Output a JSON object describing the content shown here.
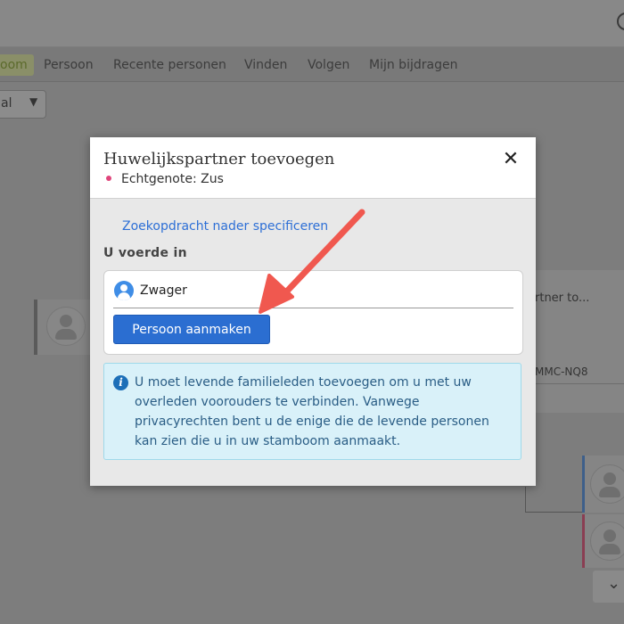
{
  "nav": {
    "active_label": "oom",
    "items": [
      "Persoon",
      "Recente personen",
      "Vinden",
      "Volgen",
      "Mijn bijdragen"
    ]
  },
  "view_select": {
    "value": "al"
  },
  "background": {
    "right_card_title": "rtner to...",
    "right_card_id": "MMC-NQ8"
  },
  "modal": {
    "title": "Huwelijkspartner toevoegen",
    "subtitle": "Echtgenote: Zus",
    "close_symbol": "✕",
    "refine_link": "Zoekopdracht nader specificeren",
    "entered_label": "U voerde in",
    "name_value": "Zwager",
    "create_button": "Persoon aanmaken",
    "info_text": "U moet levende familieleden toevoegen om u met uw overleden voorouders te verbinden. Vanwege privacyrechten bent u de enige die de levende personen kan zien die u in uw stamboom aanmaakt."
  },
  "colors": {
    "primary_button": "#2b6ed1",
    "link": "#2d6fd6",
    "info_background": "#d9f1f9",
    "annotation_arrow": "#f0584f",
    "spouse_dot": "#e0457b"
  },
  "icons": {
    "close": "close-icon",
    "person": "person-icon",
    "info": "info-icon",
    "chevron": "chevron-down-icon"
  }
}
